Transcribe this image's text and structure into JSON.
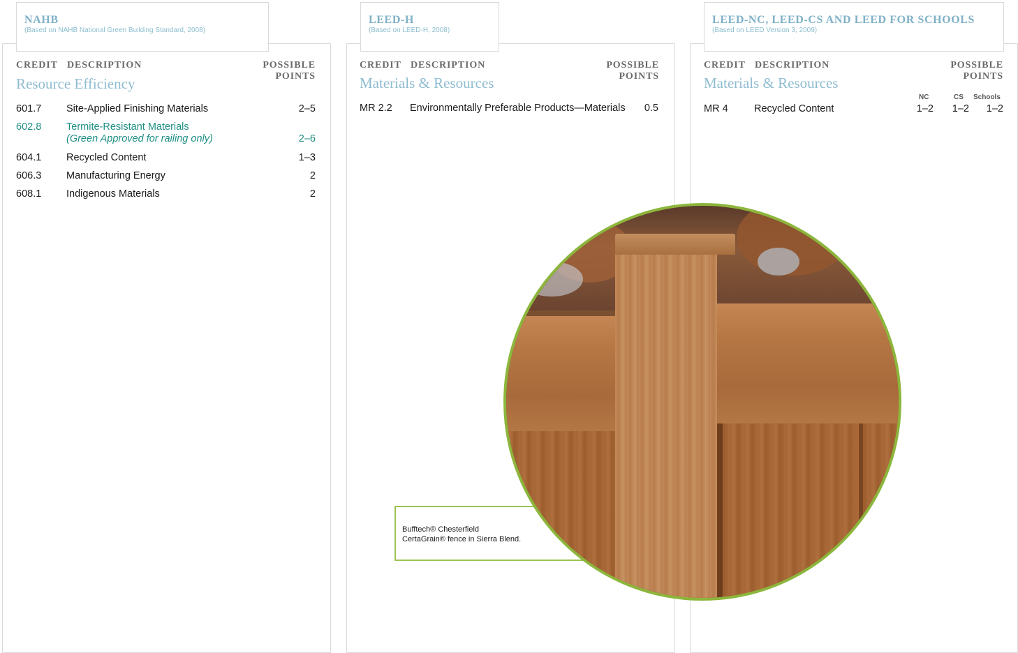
{
  "colors": {
    "accent_blue": "#8fbcd0",
    "accent_green": "#1f8f84",
    "border_green": "#8cb63c"
  },
  "panels": [
    {
      "title": "NAHB",
      "subtitle": "(Based on NAHB National Green Building Standard, 2008)",
      "col_credit": "CREDIT",
      "col_description": "DESCRIPTION",
      "col_points_1": "POSSIBLE",
      "col_points_2": "POINTS",
      "section": "Resource Efficiency",
      "rows": [
        {
          "credit": "601.7",
          "description": "Site-Applied Finishing Materials",
          "points": "2–5"
        },
        {
          "credit": "602.8",
          "description": "Termite-Resistant Materials",
          "note": "(Green Approved for railing only)",
          "points": "2–6"
        },
        {
          "credit": "604.1",
          "description": "Recycled Content",
          "points": "1–3"
        },
        {
          "credit": "606.3",
          "description": "Manufacturing Energy",
          "points": "2"
        },
        {
          "credit": "608.1",
          "description": "Indigenous Materials",
          "points": "2"
        }
      ]
    },
    {
      "title": "LEED-H",
      "subtitle": "(Based on LEED-H, 2008)",
      "col_credit": "CREDIT",
      "col_description": "DESCRIPTION",
      "col_points_1": "POSSIBLE",
      "col_points_2": "POINTS",
      "section": "Materials & Resources",
      "rows": [
        {
          "credit": "MR 2.2",
          "description": "Environmentally Preferable Products—Materials",
          "points": "0.5"
        }
      ]
    },
    {
      "title": "LEED-NC, LEED-CS AND LEED FOR SCHOOLS",
      "subtitle": "(Based on LEED Version 3, 2009)",
      "col_credit": "CREDIT",
      "col_description": "DESCRIPTION",
      "col_points_1": "POSSIBLE",
      "col_points_2": "POINTS",
      "section": "Materials & Resources",
      "sub_nc": "NC",
      "sub_cs": "CS",
      "sub_schools": "Schools",
      "rows": [
        {
          "credit": "MR 4",
          "description": "Recycled Content",
          "nc": "1–2",
          "cs": "1–2",
          "schools": "1–2"
        }
      ]
    }
  ],
  "caption": {
    "line1": "Bufftech® Chesterfield",
    "line2": "CertaGrain® fence in Sierra Blend."
  }
}
